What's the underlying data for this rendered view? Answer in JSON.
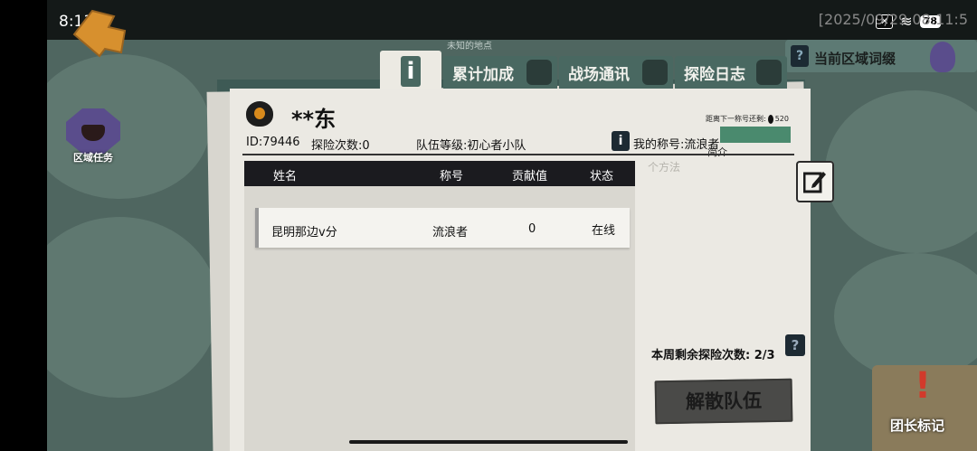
{
  "status_bar": {
    "time": "8:13",
    "ghost_timestamp": "[2025/09/29 08:11:5",
    "battery": "78"
  },
  "map": {
    "unknown_location": "未知的地点",
    "region_task_label": "区域任务",
    "current_region_affix": "当前区域词缀",
    "leader_mark_label": "团长标记"
  },
  "tabs": [
    {
      "label": ""
    },
    {
      "label": "累计加成"
    },
    {
      "label": "战场通讯"
    },
    {
      "label": "探险日志"
    }
  ],
  "team": {
    "name": "**东",
    "id_text": "ID:79446",
    "explore_count": "探险次数:0",
    "team_level": "队伍等级:初心者小队",
    "title_next": "距离下一称号还剩:",
    "title_next_value": "520",
    "my_title": "我的称号:流浪者",
    "intro_label": "简介",
    "intro_placeholder": "个方法"
  },
  "table": {
    "headers": [
      "姓名",
      "称号",
      "贡献值",
      "状态"
    ],
    "rows": [
      {
        "name": "昆明那边v分",
        "title": "流浪者",
        "contribution": "0",
        "status": "在线"
      }
    ]
  },
  "weekly": {
    "label": "本周剩余探险次数:",
    "value": "2/3"
  },
  "buttons": {
    "disband": "解散队伍"
  },
  "colors": {
    "panel_bg": "#ebe9e3",
    "tab_bg": "#496861",
    "table_header": "#1b1b1f",
    "accent_orange": "#d88a1c",
    "alert_red": "#d23a2b"
  }
}
